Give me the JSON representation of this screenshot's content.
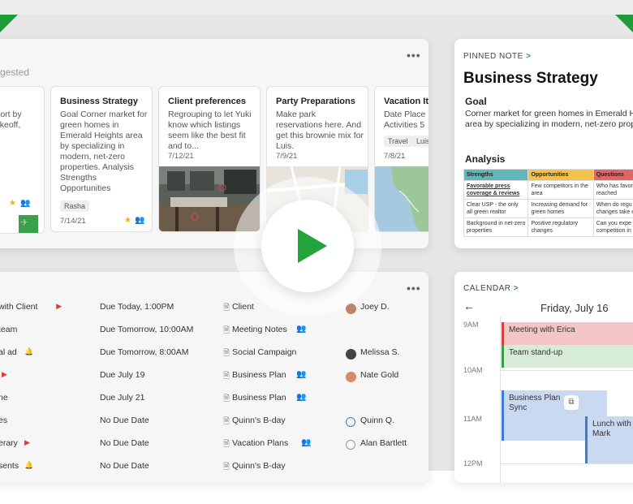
{
  "notes": {
    "section_label": "gested",
    "more": "•••",
    "cards": [
      {
        "title": "ls",
        "body": "rport by\n takeoff,",
        "qr_number": "7"
      },
      {
        "title": "Business Strategy",
        "body": "Goal Corner market for green homes in Emerald Heights area by specializing in modern, net-zero properties. Analysis Strengths Opportunities",
        "tag": "Rasha",
        "date": "7/14/21"
      },
      {
        "title": "Client preferences",
        "body": "Regrouping to let Yuki know which listings seem like the best fit and to...",
        "date": "7/12/21"
      },
      {
        "title": "Party Preparations",
        "body": "Make park reservations here. And get this brownie mix for Luis.",
        "date": "7/9/21"
      },
      {
        "title": "Vacation Iti",
        "body": "Date Place I\nActivities 5",
        "tags": [
          "Travel",
          "Luis"
        ],
        "date": "7/8/21"
      }
    ]
  },
  "pinned": {
    "label": "PINNED NOTE",
    "chevron": ">",
    "title": "Business Strategy",
    "goal_head": "Goal",
    "goal_text": "Corner market for green homes in Emerald Heights area by specializing in modern, net-zero properties.",
    "analysis_head": "Analysis",
    "swot": {
      "headers": [
        "Strengths",
        "Opportunities",
        "Questions"
      ],
      "rows": [
        [
          "Favorable press coverage & reviews",
          "Few competitors in the area",
          "Who has favor actually reached"
        ],
        [
          "Clear USP - the only all green realtor",
          "Increasing demand for green homes",
          "When do regu changes take e"
        ],
        [
          "Background in net-zero properties",
          "Positive regulatory changes",
          "Can you expe competition in"
        ]
      ]
    }
  },
  "tasks": {
    "more": "•••",
    "rows": [
      {
        "name": " with Client",
        "badge": "flag",
        "due": "Due Today, 1:00PM",
        "note": "Client",
        "assignee": "Joey D.",
        "assignee_style": "photo"
      },
      {
        "name": " team",
        "badge": "",
        "due": "Due Tomorrow, 10:00AM",
        "note": "Meeting Notes",
        "note_shared": true,
        "assignee": "",
        "assignee_style": ""
      },
      {
        "name": "al ad",
        "badge": "bell",
        "due": "Due Tomorrow, 8:00AM",
        "note": "Social Campaign",
        "assignee": "Melissa S.",
        "assignee_style": "dark"
      },
      {
        "name": "",
        "badge": "flag",
        "due": "Due July 19",
        "note": "Business Plan",
        "note_shared": true,
        "assignee": "Nate Gold",
        "assignee_style": "photo2"
      },
      {
        "name": "ne",
        "badge": "",
        "due": "Due July 21",
        "note": "Business Plan",
        "note_shared": true,
        "assignee": "",
        "assignee_style": ""
      },
      {
        "name": "es",
        "badge": "",
        "due": "No Due Date",
        "note": "Quinn's B-day",
        "assignee": "Quinn Q.",
        "assignee_style": "outline"
      },
      {
        "name": "erary",
        "badge": "flag",
        "due": "No Due Date",
        "note": "Vacation Plans",
        "note_shared": true,
        "assignee": "Alan Bartlett",
        "assignee_style": "outline-gray"
      },
      {
        "name": "sents",
        "badge": "bell",
        "due": "No Due Date",
        "note": "Quinn's B-day",
        "assignee": "",
        "assignee_style": ""
      }
    ]
  },
  "calendar": {
    "label": "CALENDAR",
    "chevron": ">",
    "back_arrow": "←",
    "date": "Friday, July 16",
    "hours": [
      "9AM",
      "10AM",
      "11AM",
      "12PM"
    ],
    "events": [
      {
        "title": "Meeting with Erica",
        "color": "red"
      },
      {
        "title": "Team stand-up",
        "color": "green"
      },
      {
        "title": "Business Plan Sync",
        "color": "blue"
      },
      {
        "title": "Lunch with Mark",
        "color": "blue"
      }
    ]
  },
  "colors": {
    "accent": "#23a53c",
    "flag": "#d83b3b",
    "bell": "#3a7bd5"
  }
}
